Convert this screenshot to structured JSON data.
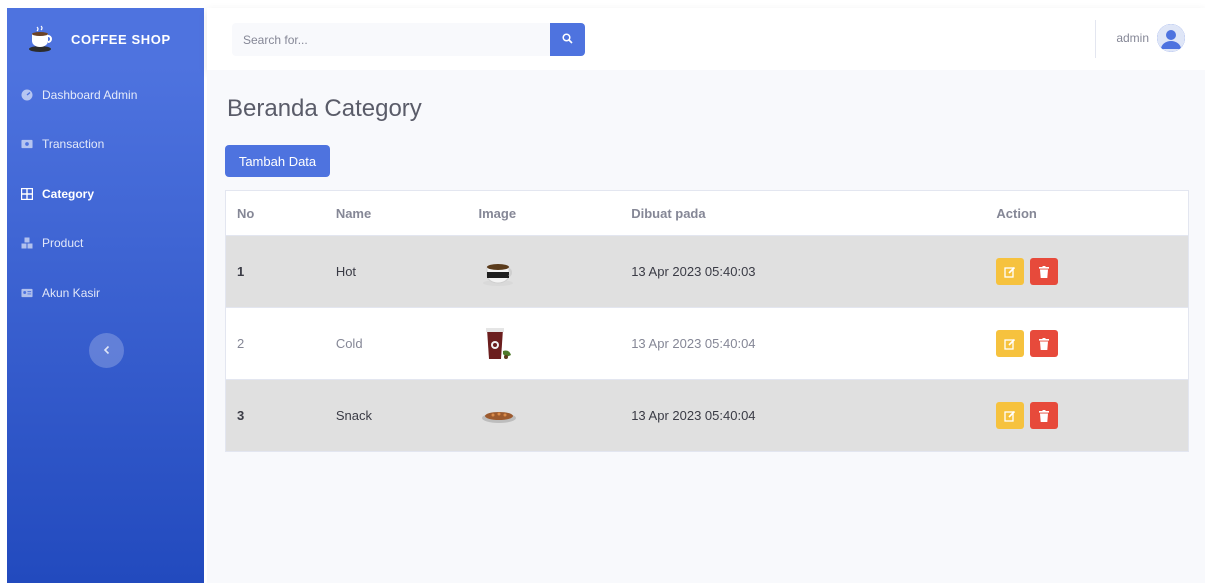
{
  "brand": {
    "name": "COFFEE SHOP",
    "logo_icon": "coffee-cup-icon"
  },
  "sidebar": {
    "items": [
      {
        "label": "Dashboard Admin",
        "icon": "dashboard-icon",
        "active": false
      },
      {
        "label": "Transaction",
        "icon": "money-icon",
        "active": false
      },
      {
        "label": "Category",
        "icon": "grid-icon",
        "active": true
      },
      {
        "label": "Product",
        "icon": "boxes-icon",
        "active": false
      },
      {
        "label": "Akun Kasir",
        "icon": "id-card-icon",
        "active": false
      }
    ],
    "toggle_icon": "chevron-left-icon"
  },
  "topbar": {
    "search_placeholder": "Search for...",
    "search_icon": "search-icon",
    "user_name": "admin",
    "avatar_icon": "user-avatar-icon"
  },
  "page": {
    "title": "Beranda Category",
    "add_button": "Tambah Data"
  },
  "table": {
    "headers": [
      "No",
      "Name",
      "Image",
      "Dibuat pada",
      "Action"
    ],
    "rows": [
      {
        "no": "1",
        "name": "Hot",
        "image": "hot-coffee-icon",
        "created": "13 Apr 2023 05:40:03"
      },
      {
        "no": "2",
        "name": "Cold",
        "image": "cold-drink-icon",
        "created": "13 Apr 2023 05:40:04"
      },
      {
        "no": "3",
        "name": "Snack",
        "image": "snack-plate-icon",
        "created": "13 Apr 2023 05:40:04"
      }
    ],
    "edit_icon": "edit-icon",
    "delete_icon": "trash-icon"
  },
  "colors": {
    "primary": "#4e73df",
    "warning": "#f6c23e",
    "danger": "#e74a3b"
  }
}
